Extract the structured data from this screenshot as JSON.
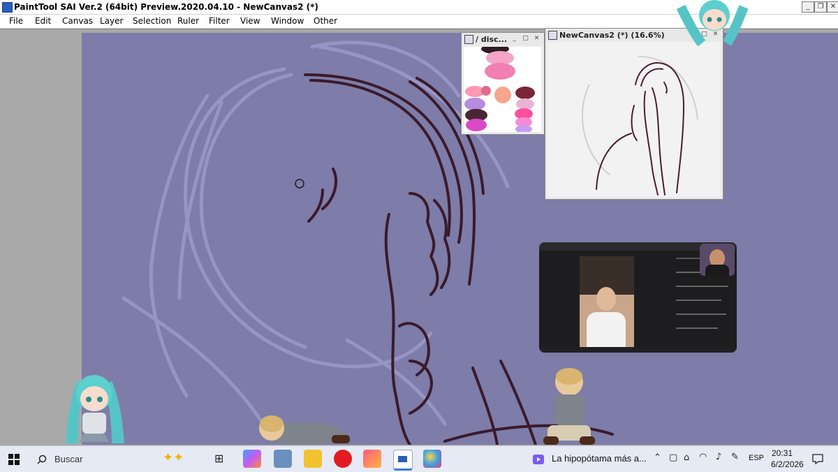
{
  "window": {
    "title": "PaintTool SAI Ver.2 (64bit) Preview.2020.04.10 - NewCanvas2 (*)",
    "minimize": "_",
    "restore": "❐",
    "close": "✕"
  },
  "menu": {
    "items": [
      "File",
      "Edit",
      "Canvas",
      "Layer",
      "Selection",
      "Ruler",
      "Filter",
      "View",
      "Window",
      "Other"
    ]
  },
  "palette_window": {
    "title": "/ disc...",
    "swatch_colors": [
      "#2d1c24",
      "#f6a3c8",
      "#f27fb1",
      "#ff98b2",
      "#e26a8c",
      "#f7a58f",
      "#7a2438",
      "#b68be0",
      "#e9b3d3",
      "#ff4f9e",
      "#4a2634",
      "#d94ac4",
      "#f78ad4",
      "#c49cf0"
    ]
  },
  "navigator_window": {
    "title": "NewCanvas2 (*) (16.6%)"
  },
  "colors": {
    "canvas_bg": "#7e7ca8",
    "stroke": "#3a1a2c",
    "sketch": "#9a98c6"
  },
  "taskbar": {
    "search_label": "Buscar",
    "media_label": "La hipopótama más a...",
    "language": "ESP",
    "time": "20:31",
    "date": "6/2/2026",
    "icons": [
      "windows-start-icon",
      "search-icon",
      "copilot-icon",
      "task-view-icon",
      "copilot-app-icon",
      "photos-icon",
      "file-explorer-icon",
      "opera-icon",
      "app-icon",
      "paint-sai-icon",
      "paint-icon"
    ]
  }
}
